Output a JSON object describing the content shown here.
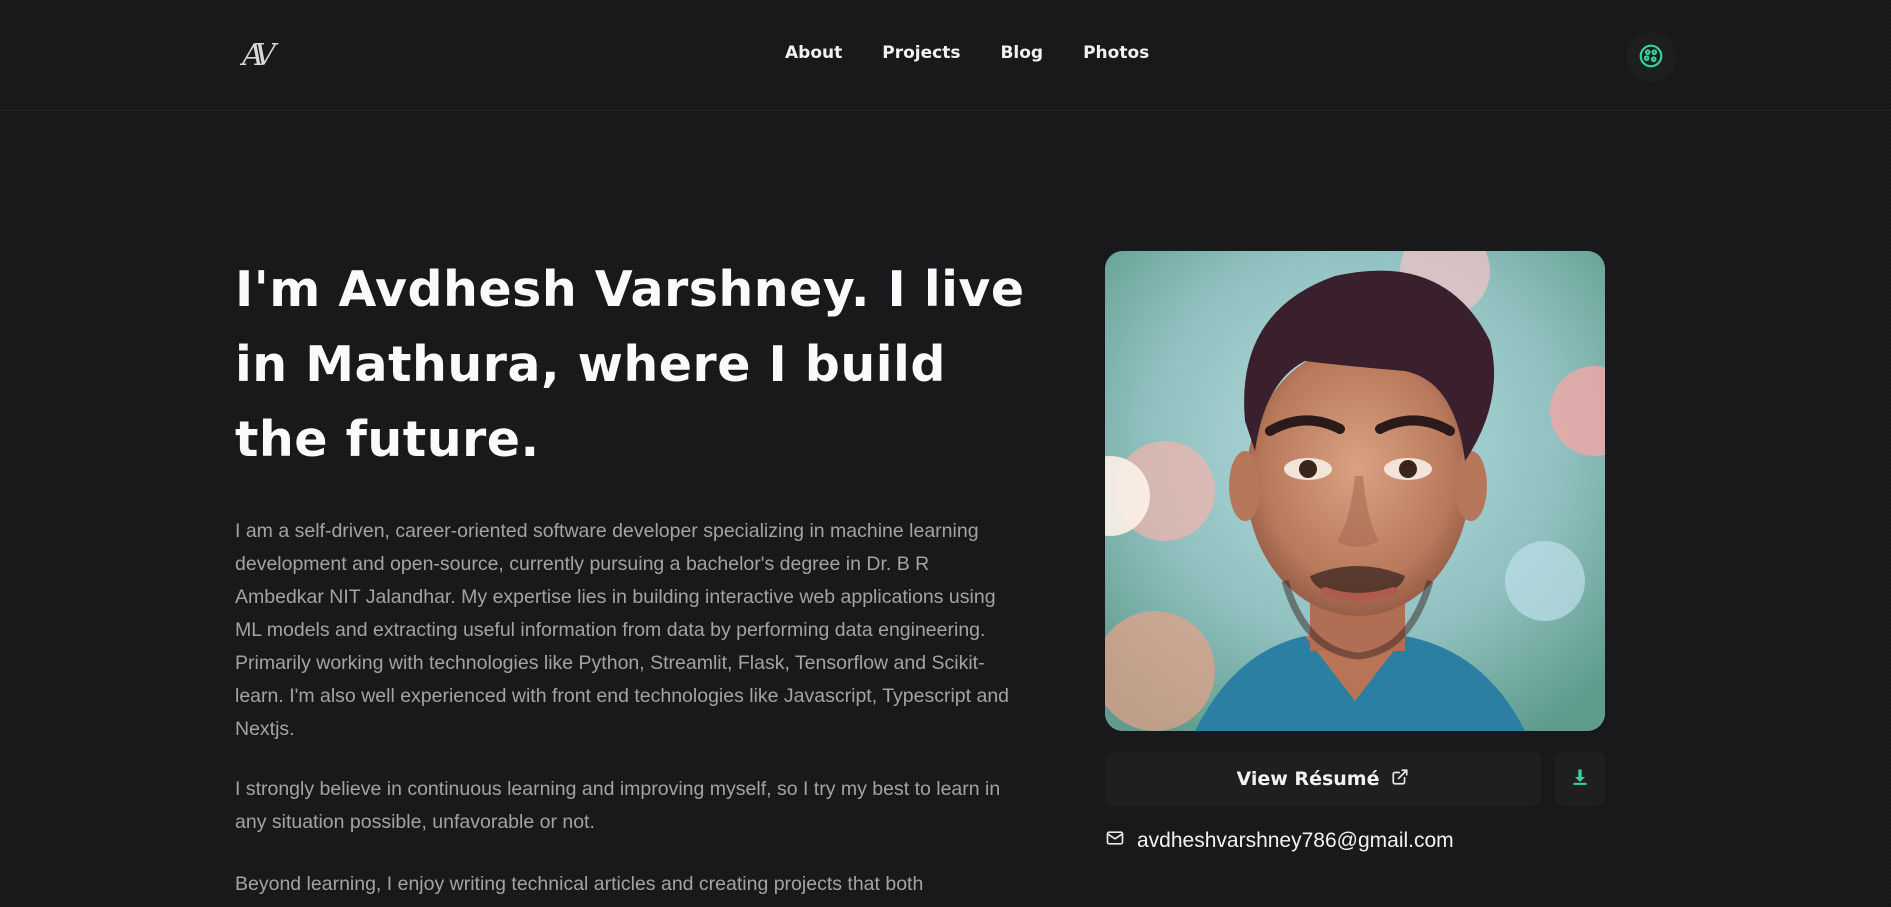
{
  "header": {
    "logo_text": "AV",
    "nav": [
      {
        "label": "About"
      },
      {
        "label": "Projects"
      },
      {
        "label": "Blog"
      },
      {
        "label": "Photos"
      }
    ],
    "theme_toggle_icon": "palette-icon"
  },
  "hero": {
    "headline": "I'm Avdhesh Varshney. I live in Mathura, where I build the future.",
    "paragraphs": [
      "I am a self-driven, career-oriented software developer specializing in machine learning development and open-source, currently pursuing a bachelor's degree in Dr. B R Ambedkar NIT Jalandhar. My expertise lies in building interactive web applications using ML models and extracting useful information from data by performing data engineering. Primarily working with technologies like Python, Streamlit, Flask, Tensorflow and Scikit-learn. I'm also well experienced with front end technologies like Javascript, Typescript and Nextjs.",
      "I strongly believe in continuous learning and improving myself, so I try my best to learn in any situation possible, unfavorable or not.",
      "Beyond learning, I enjoy writing technical articles and creating projects that both"
    ]
  },
  "profile": {
    "resume_label": "View Résumé",
    "resume_icon": "external-link-icon",
    "download_icon": "download-icon",
    "email_icon": "mail-icon",
    "email": "avdheshvarshney786@gmail.com"
  },
  "colors": {
    "background": "#18181a",
    "accent": "#34d399",
    "button_bg": "#1f1f22"
  }
}
